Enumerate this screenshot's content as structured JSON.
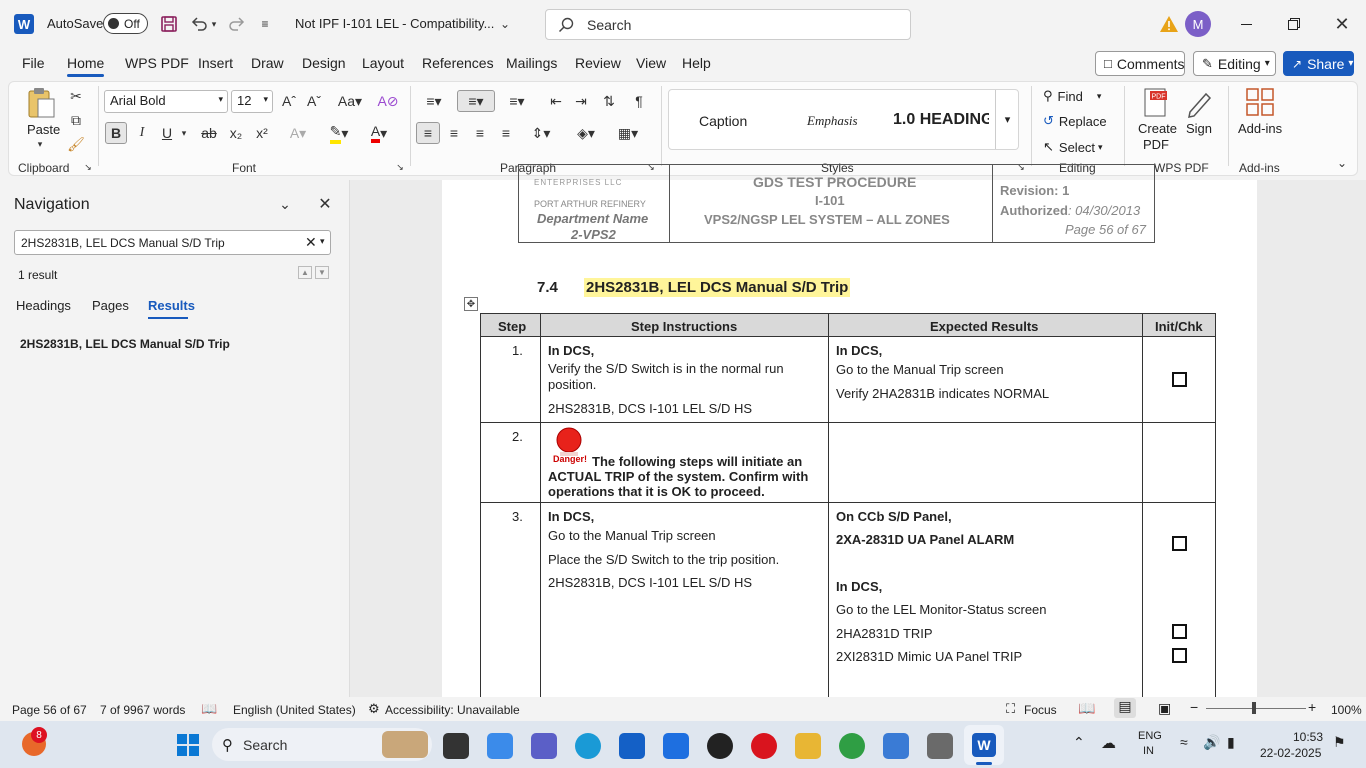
{
  "titlebar": {
    "autosave_label": "AutoSave",
    "autosave_state": "Off",
    "doc_title": "Not IPF I-101 LEL  -  Compatibility...",
    "search_placeholder": "Search",
    "avatar_initial": "M"
  },
  "menu": {
    "tabs": [
      "File",
      "Home",
      "WPS PDF",
      "Insert",
      "Draw",
      "Design",
      "Layout",
      "References",
      "Mailings",
      "Review",
      "View",
      "Help"
    ],
    "active_tab": "Home",
    "comments": "Comments",
    "editing": "Editing",
    "share": "Share"
  },
  "ribbon": {
    "paste": "Paste",
    "font_name": "Arial Bold",
    "font_size": "12",
    "styles": [
      "Caption",
      "Emphasis",
      "1.0  HEADING"
    ],
    "find": "Find",
    "replace": "Replace",
    "select": "Select",
    "create_pdf": "Create PDF",
    "sign": "Sign",
    "addins": "Add-ins",
    "groups": {
      "clipboard": "Clipboard",
      "font": "Font",
      "paragraph": "Paragraph",
      "styles": "Styles",
      "editing": "Editing",
      "wps_pdf": "WPS PDF",
      "addins": "Add-ins"
    }
  },
  "navigation": {
    "title": "Navigation",
    "search_value": "2HS2831B, LEL DCS Manual S/D Trip",
    "result_count": "1 result",
    "tabs": [
      "Headings",
      "Pages",
      "Results"
    ],
    "active_tab": "Results",
    "results": [
      "2HS2831B, LEL DCS Manual S/D Trip"
    ]
  },
  "document": {
    "header": {
      "company_line": "ENTERPRISES LLC",
      "refinery": "PORT ARTHUR REFINERY",
      "department": "Department Name",
      "dept_code": "2-VPS2",
      "proc_title": "GDS TEST PROCEDURE",
      "proc_id": "I-101",
      "proc_subtitle": "VPS2/NGSP LEL SYSTEM – ALL ZONES",
      "revision": "Revision: 1",
      "authorized_label": "Authorized",
      "authorized_date": ": 04/30/2013",
      "page_of": "Page 56 of 67"
    },
    "section_number": "7.4",
    "section_title": "2HS2831B, LEL DCS Manual S/D Trip",
    "table": {
      "headers": [
        "Step",
        "Step Instructions",
        "Expected Results",
        "Init/Chk"
      ],
      "rows": [
        {
          "step": "1.",
          "instructions": [
            "In DCS,",
            "Verify the S/D Switch is in the normal run position.",
            "2HS2831B, DCS I-101 LEL S/D HS"
          ],
          "results": [
            "In DCS,",
            "Go to the Manual Trip screen",
            "Verify 2HA2831B indicates NORMAL"
          ]
        },
        {
          "step": "2.",
          "danger_label": "Danger!",
          "instructions": [
            "The following steps will initiate an ACTUAL TRIP of the system. Confirm with operations that it is OK to proceed."
          ],
          "results": []
        },
        {
          "step": "3.",
          "instructions": [
            "In DCS,",
            "Go to the Manual Trip screen",
            "Place the S/D Switch to the trip position.",
            "2HS2831B, DCS I-101 LEL S/D HS"
          ],
          "results": [
            "On CCb S/D Panel,",
            "2XA-2831D UA Panel ALARM",
            "In DCS,",
            "Go to the LEL Monitor-Status screen",
            "2HA2831D TRIP",
            "2XI2831D Mimic UA Panel TRIP"
          ],
          "results_bold_parts": [
            "On ",
            "CCb S/D Panel",
            "2XA-2831D UA Panel ALARM",
            "In DCS",
            "2HA2831D",
            "2XI2831D"
          ]
        }
      ]
    }
  },
  "statusbar": {
    "page": "Page 56 of 67",
    "words": "7 of 9967 words",
    "language": "English (United States)",
    "accessibility": "Accessibility: Unavailable",
    "focus": "Focus",
    "zoom": "100%"
  },
  "taskbar": {
    "search": "Search",
    "notification_count": "8",
    "lang_line1": "ENG",
    "lang_line2": "IN",
    "time": "10:53",
    "date": "22-02-2025"
  }
}
